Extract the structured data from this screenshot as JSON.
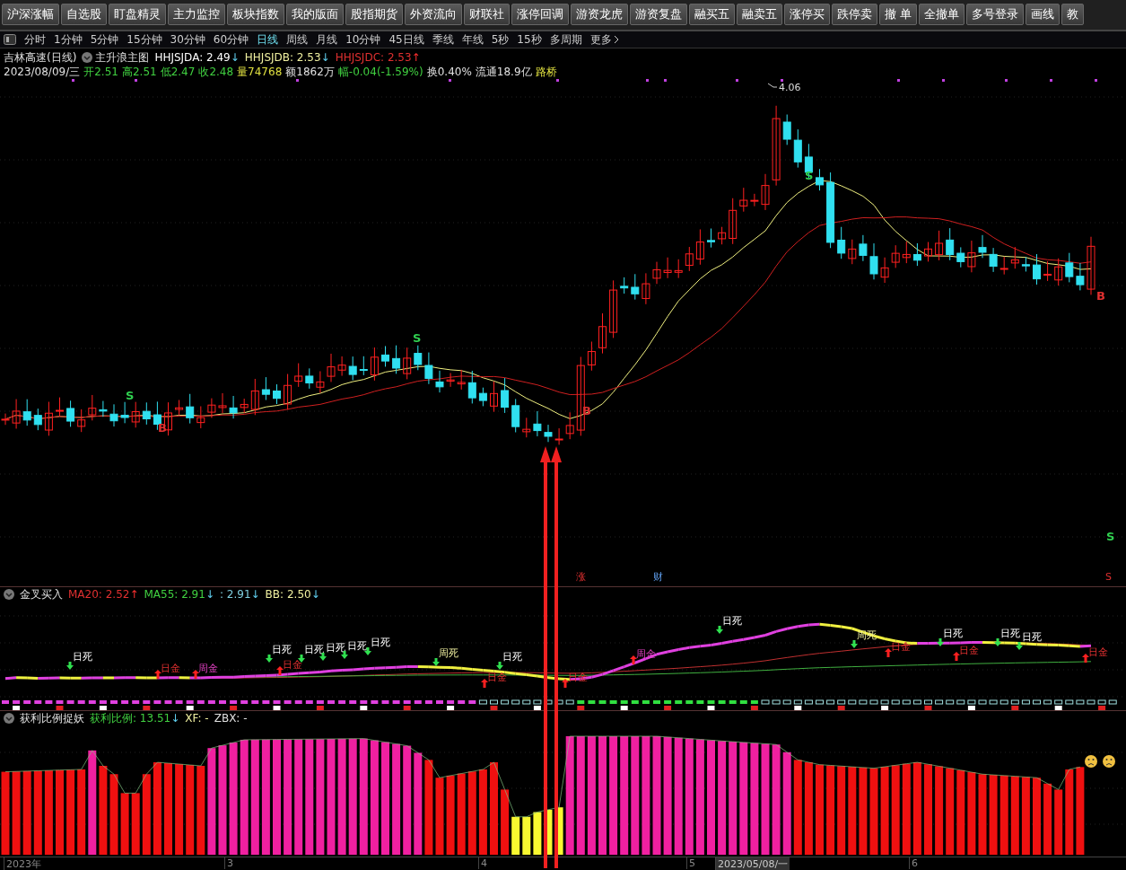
{
  "toolbar": {
    "buttons": [
      "沪深涨幅",
      "自选股",
      "盯盘精灵",
      "主力监控",
      "板块指数",
      "我的版面",
      "股指期货",
      "外资流向",
      "财联社",
      "涨停回调",
      "游资龙虎",
      "游资复盘",
      "融买五",
      "融卖五",
      "涨停买",
      "跌停卖",
      "撤 单",
      "全撤单",
      "多号登录",
      "画线",
      "教"
    ]
  },
  "periods": [
    {
      "label": "分时",
      "selected": false
    },
    {
      "label": "1分钟",
      "selected": false
    },
    {
      "label": "5分钟",
      "selected": false
    },
    {
      "label": "15分钟",
      "selected": false
    },
    {
      "label": "30分钟",
      "selected": false
    },
    {
      "label": "60分钟",
      "selected": false
    },
    {
      "label": "日线",
      "selected": true
    },
    {
      "label": "周线",
      "selected": false
    },
    {
      "label": "月线",
      "selected": false
    },
    {
      "label": "10分钟",
      "selected": false
    },
    {
      "label": "45日线",
      "selected": false
    },
    {
      "label": "季线",
      "selected": false
    },
    {
      "label": "年线",
      "selected": false
    },
    {
      "label": "5秒",
      "selected": false
    },
    {
      "label": "15秒",
      "selected": false
    },
    {
      "label": "多周期",
      "selected": false
    }
  ],
  "more_link": "更多",
  "main_panel": {
    "stock": "吉林高速(日线)",
    "indicator": "主升浪主图",
    "values": [
      {
        "text": "HHJSJDA: 2.49",
        "arrow": "↓",
        "rising": false,
        "color": "#ffffff"
      },
      {
        "text": "HHJSJDB: 2.53",
        "arrow": "↓",
        "rising": false,
        "color": "#f0f0a0"
      },
      {
        "text": "HHJSJDC: 2.53",
        "arrow": "↑",
        "rising": true,
        "color": "#e03030"
      }
    ],
    "quote": [
      {
        "text": "2023/08/09/三",
        "color": "#e0e0e0"
      },
      {
        "text": "开2.51",
        "color": "#40d040"
      },
      {
        "text": "高2.51",
        "color": "#40d040"
      },
      {
        "text": "低2.47",
        "color": "#40d040"
      },
      {
        "text": "收2.48",
        "color": "#40d040"
      },
      {
        "text": "量74768",
        "color": "#e0e040"
      },
      {
        "text": "额1862万",
        "color": "#e0e0e0"
      },
      {
        "text": "幅-0.04(-1.59%)",
        "color": "#40d040"
      },
      {
        "text": "换0.40%",
        "color": "#e0e0e0"
      },
      {
        "text": "流通18.9亿",
        "color": "#e0e0e0"
      },
      {
        "text": "路桥",
        "color": "#e0e040"
      }
    ],
    "high_label": "4.06",
    "signals": [
      {
        "label": "S",
        "kind": "sell"
      },
      {
        "label": "B",
        "kind": "buy"
      },
      {
        "label": "S",
        "kind": "sell"
      },
      {
        "label": "B",
        "kind": "buy"
      },
      {
        "label": "S",
        "kind": "sell"
      },
      {
        "label": "B",
        "kind": "buy"
      },
      {
        "label": "S",
        "kind": "sell"
      }
    ],
    "events": [
      {
        "label": "涨",
        "kind": "limit_up"
      },
      {
        "label": "财",
        "kind": "finance"
      },
      {
        "label": "S",
        "kind": "limit_up"
      }
    ]
  },
  "cross_panel": {
    "title": "金叉买入",
    "values": [
      {
        "text": "MA20: 2.52",
        "arrow": "↑",
        "rising": true,
        "color": "#e03030"
      },
      {
        "text": "MA55: 2.91",
        "arrow": "↓",
        "rising": false,
        "color": "#40d040"
      },
      {
        "text": ": 2.91",
        "arrow": "↓",
        "rising": false,
        "color": "#80d0e0"
      },
      {
        "text": "BB: 2.50",
        "arrow": "↓",
        "rising": false,
        "color": "#f0f0a0"
      }
    ],
    "signals": [
      {
        "label": "日死",
        "kind": "death"
      },
      {
        "label": "日金",
        "kind": "golden"
      },
      {
        "label": "周金",
        "kind": "weekly_golden"
      },
      {
        "label": "日死",
        "kind": "death"
      },
      {
        "label": "日金",
        "kind": "golden"
      },
      {
        "label": "日死",
        "kind": "death"
      },
      {
        "label": "日死",
        "kind": "death"
      },
      {
        "label": "日死",
        "kind": "death"
      },
      {
        "label": "日死",
        "kind": "death"
      },
      {
        "label": "周死",
        "kind": "weekly_death"
      },
      {
        "label": "日死",
        "kind": "death"
      },
      {
        "label": "日金",
        "kind": "golden"
      },
      {
        "label": "日金",
        "kind": "golden"
      },
      {
        "label": "周金",
        "kind": "weekly_golden"
      },
      {
        "label": "日死",
        "kind": "death"
      },
      {
        "label": "周死",
        "kind": "weekly_death"
      },
      {
        "label": "日金",
        "kind": "golden"
      },
      {
        "label": "日死",
        "kind": "death"
      },
      {
        "label": "日金",
        "kind": "golden"
      },
      {
        "label": "日死",
        "kind": "death"
      },
      {
        "label": "日死",
        "kind": "death"
      },
      {
        "label": "日金",
        "kind": "golden"
      }
    ]
  },
  "profit_panel": {
    "title": "获利比例捉妖",
    "values": [
      {
        "text": "获利比例: 13.51",
        "arrow": "↓",
        "rising": false,
        "color": "#40d040"
      },
      {
        "text": "XF: -",
        "color": "#f0f0a0"
      },
      {
        "text": "ZBX: -",
        "color": "#e0e0e0"
      }
    ]
  },
  "time_axis": [
    {
      "label": "2023年",
      "selected": false
    },
    {
      "label": "3",
      "selected": false
    },
    {
      "label": "4",
      "selected": false
    },
    {
      "label": "5",
      "selected": false
    },
    {
      "label": "2023/05/08/一",
      "selected": true
    },
    {
      "label": "6",
      "selected": false
    }
  ]
}
